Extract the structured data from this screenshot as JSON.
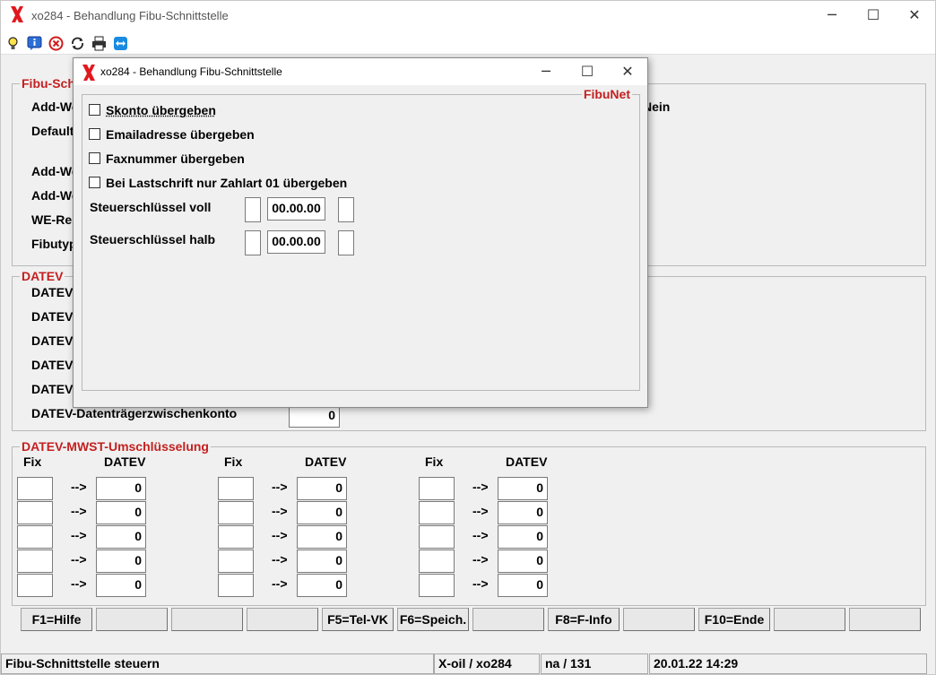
{
  "main": {
    "title": "xo284 - Behandlung Fibu-Schnittstelle",
    "window_controls": {
      "minimize": "─",
      "maximize": "☐",
      "close": "✕"
    },
    "toolbar_icons": [
      "lightbulb-icon",
      "info-icon",
      "cancel-icon",
      "refresh-icon",
      "print-icon",
      "remote-support-icon"
    ],
    "fibu_group": {
      "title": "Fibu-Sch",
      "labels": [
        "Add-We",
        "Default",
        "Add-We",
        "Add-We",
        "WE-Re",
        "Fibutyp"
      ],
      "nein": "Nein"
    },
    "datev_group": {
      "title": "DATEV",
      "labels": [
        "DATEV",
        "DATEV",
        "DATEV",
        "DATEV",
        "DATEV",
        "DATEV-Datenträgerzwischenkonto"
      ],
      "zwischenkonto_value": "0"
    },
    "mwst_group": {
      "title": "DATEV-MWST-Umschlüsselung",
      "col_fix": "Fix",
      "col_datev": "DATEV",
      "arrow": "-->",
      "columns": [
        {
          "values": [
            "0",
            "0",
            "0",
            "0",
            "0"
          ]
        },
        {
          "values": [
            "0",
            "0",
            "0",
            "0",
            "0"
          ]
        },
        {
          "values": [
            "0",
            "0",
            "0",
            "0",
            "0"
          ]
        }
      ]
    },
    "fkeys": [
      "F1=Hilfe",
      "",
      "",
      "",
      "F5=Tel-VK",
      "F6=Speich.",
      "",
      "F8=F-Info",
      "",
      "F10=Ende",
      "",
      ""
    ],
    "statusbar": {
      "message": "Fibu-Schnittstelle steuern",
      "program": "X-oil / xo284",
      "record": "na / 131",
      "datetime": "20.01.22 14:29"
    }
  },
  "dialog": {
    "title": "xo284 - Behandlung Fibu-Schnittstelle",
    "group_title": "FibuNet",
    "checkboxes": [
      {
        "label": "Skonto übergeben",
        "checked": false
      },
      {
        "label": "Emailadresse übergeben",
        "checked": false
      },
      {
        "label": "Faxnummer übergeben",
        "checked": false
      },
      {
        "label": "Bei Lastschrift nur Zahlart 01 übergeben",
        "checked": false
      }
    ],
    "steuer_voll": {
      "label": "Steuerschlüssel voll",
      "value": "00.00.00"
    },
    "steuer_halb": {
      "label": "Steuerschlüssel halb",
      "value": "00.00.00"
    }
  },
  "colors": {
    "accent_red": "#c42020",
    "logo_red": "#e0191f"
  }
}
